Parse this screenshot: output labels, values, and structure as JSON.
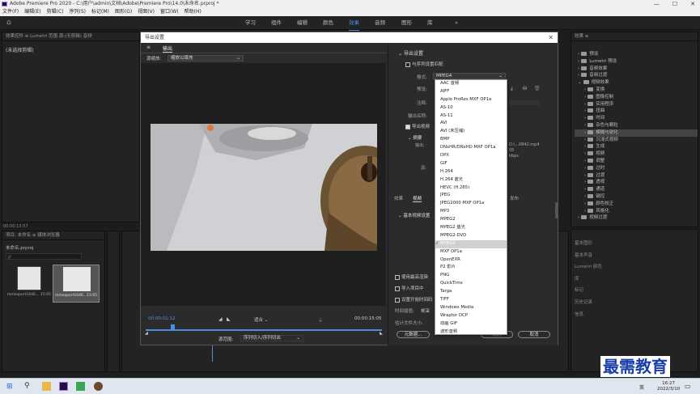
{
  "app": {
    "title": "Adobe Premiere Pro 2020 - C:\\用户\\admin\\文档\\Adobe\\Premiere Pro\\14.0\\未命名.prproj *",
    "win_min": "—",
    "win_max": "☐",
    "win_close": "✕"
  },
  "menu": [
    "文件(F)",
    "编辑(E)",
    "剪辑(C)",
    "序列(S)",
    "标记(M)",
    "图形(G)",
    "视图(V)",
    "窗口(W)",
    "帮助(H)"
  ],
  "workspaces": [
    "学习",
    "组件",
    "编辑",
    "颜色",
    "效果",
    "音频",
    "图形",
    "库"
  ],
  "workspace_overflow": "»",
  "home_icon": "⌂",
  "left_top_panel": {
    "tabs": "效果控件 ≡   Lumetri 范围   源:(无剪辑)   音频",
    "content": "(未选择剪辑)"
  },
  "left_bottom_panel": {
    "tabs": "项目: 未命名 ≡   媒体浏览器",
    "timecode": "00:00:13:57",
    "project_file": "未命名.prproj",
    "search_placeholder": "ρ",
    "items": [
      {
        "name": "mmexport1646...",
        "duration": "15:05"
      },
      {
        "name": "mmexport1646...",
        "duration": "15:05"
      }
    ]
  },
  "dialog": {
    "title": "导出设置",
    "close": "✕",
    "tab_menu": "≡",
    "tab_output": "输出",
    "source_scaling_label": "源缩放:",
    "source_scaling_value": "缩放以填充",
    "timecode_in": "00:00:01:12",
    "timecode_out": "00:00:15:05",
    "fit_value": "适合",
    "source_range_label": "源范围:",
    "source_range_value": "序列切入/序列切出",
    "export_settings_header": "导出设置",
    "match_sequence": "与序列设置匹配",
    "format_label": "格式:",
    "format_value": "MPEG4",
    "preset_label": "预设:",
    "comment_label": "注释:",
    "output_name_label": "输出名称:",
    "export_video": "导出视频",
    "summary_header": "摘要",
    "summary_output_label": "输出:",
    "summary_output_value": "D:\\...0842.mp4",
    "summary_line2": "05",
    "summary_line3": "kbps",
    "summary_source_label": "源:",
    "tab_effects": "效果",
    "tab_video": "视频",
    "tab_publish": "发布",
    "basic_video_header": "基本视频设置",
    "use_max_render": "使用最高渲染",
    "import_into_project": "导入项目中",
    "set_start_timecode": "设置开始时间码",
    "time_interpolation_label": "时间插值:",
    "time_interpolation_value": "帧采",
    "est_file_size_label": "估计文件大小:",
    "btn_metadata": "元数据...",
    "btn_queue": "队列",
    "btn_export": "导出",
    "btn_cancel": "取消"
  },
  "format_options": [
    "AAC 音频",
    "AIFF",
    "Apple ProRes MXF OP1a",
    "AS-10",
    "AS-11",
    "AVI",
    "AVI (未压缩)",
    "BMP",
    "DNxHR/DNxHD MXF OP1a",
    "DPX",
    "GIF",
    "H.264",
    "H.264 蓝光",
    "HEVC (H.265)",
    "JPEG",
    "JPEG2000 MXF OP1a",
    "MP3",
    "MPEG2",
    "MPEG2 蓝光",
    "MPEG2-DVD",
    "MPEG4",
    "MXF OP1a",
    "OpenEXR",
    "P2 影片",
    "PNG",
    "QuickTime",
    "Targa",
    "TIFF",
    "Windows Media",
    "Wraptor DCP",
    "动画 GIF",
    "波形音频"
  ],
  "format_selected": "MPEG4",
  "format_check": "✓",
  "effects_panel": {
    "title": "效果 ≡",
    "items": [
      {
        "label": "预设",
        "hl": false
      },
      {
        "label": "Lumetri 预设",
        "hl": false
      },
      {
        "label": "音频效果",
        "hl": false
      },
      {
        "label": "音频过渡",
        "hl": false
      },
      {
        "label": "视频效果",
        "hl": false
      },
      {
        "label": "变换",
        "hl": false
      },
      {
        "label": "图像控制",
        "hl": false
      },
      {
        "label": "实用程序",
        "hl": false
      },
      {
        "label": "扭曲",
        "hl": false
      },
      {
        "label": "时间",
        "hl": false
      },
      {
        "label": "杂色与颗粒",
        "hl": false
      },
      {
        "label": "模糊与锐化",
        "hl": true
      },
      {
        "label": "沉浸式视频",
        "hl": false
      },
      {
        "label": "生成",
        "hl": false
      },
      {
        "label": "视频",
        "hl": false
      },
      {
        "label": "调整",
        "hl": false
      },
      {
        "label": "过时",
        "hl": false
      },
      {
        "label": "过渡",
        "hl": false
      },
      {
        "label": "透视",
        "hl": false
      },
      {
        "label": "通道",
        "hl": false
      },
      {
        "label": "键控",
        "hl": false
      },
      {
        "label": "颜色校正",
        "hl": false
      },
      {
        "label": "风格化",
        "hl": false
      },
      {
        "label": "视频过渡",
        "hl": false
      }
    ],
    "bottom_sections": [
      "基本图形",
      "基本声音",
      "Lumetri 颜色",
      "库",
      "标记",
      "历史记录",
      "信息"
    ]
  },
  "watermark": "最需教育",
  "taskbar": {
    "time": "16:27",
    "date": "2022/3/10",
    "lang": "英"
  }
}
